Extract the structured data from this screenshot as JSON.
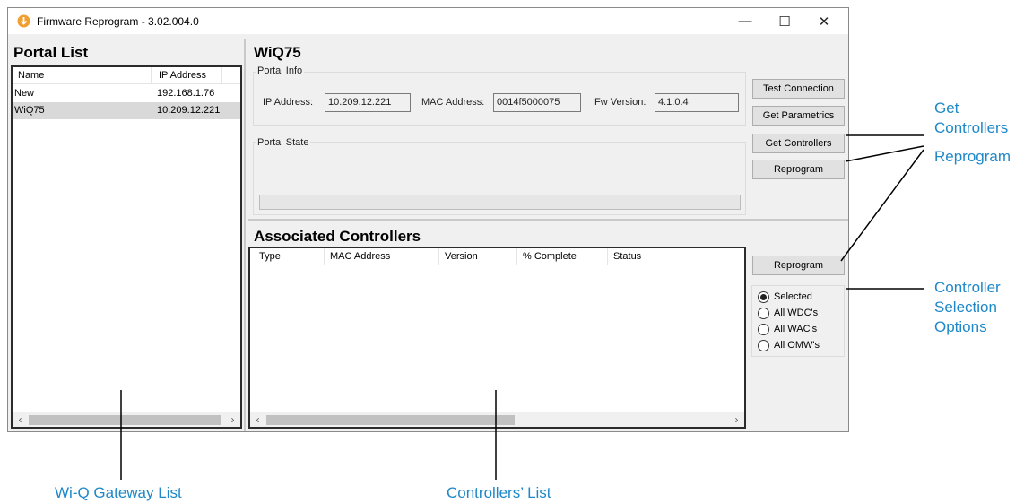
{
  "window": {
    "title": "Firmware Reprogram - 3.02.004.0",
    "controls": {
      "minimize": "—",
      "maximize": "☐",
      "close": "✕"
    }
  },
  "portal_list": {
    "title": "Portal List",
    "columns": [
      "Name",
      "IP Address"
    ],
    "rows": [
      {
        "name": "New",
        "ip": "192.168.1.76",
        "selected": false
      },
      {
        "name": "WiQ75",
        "ip": "10.209.12.221",
        "selected": true
      }
    ]
  },
  "portal": {
    "name": "WiQ75",
    "info_label": "Portal Info",
    "ip_label": "IP Address:",
    "ip_value": "10.209.12.221",
    "mac_label": "MAC Address:",
    "mac_value": "0014f5000075",
    "fw_label": "Fw Version:",
    "fw_value": "4.1.0.4",
    "state_label": "Portal State",
    "progress": 0
  },
  "buttons": {
    "test_connection": "Test Connection",
    "get_parametrics": "Get Parametrics",
    "get_controllers": "Get Controllers",
    "reprogram_portal": "Reprogram",
    "reprogram_controllers": "Reprogram"
  },
  "controllers": {
    "title": "Associated Controllers",
    "columns": [
      "Type",
      "MAC Address",
      "Version",
      "% Complete",
      "Status"
    ],
    "rows": []
  },
  "selection": {
    "options": [
      {
        "label": "Selected",
        "checked": true
      },
      {
        "label": "All WDC's",
        "checked": false
      },
      {
        "label": "All WAC's",
        "checked": false
      },
      {
        "label": "All OMW's",
        "checked": false
      }
    ]
  },
  "scroll": {
    "left_arrow": "‹",
    "right_arrow": "›"
  },
  "callouts": {
    "get_controllers": [
      "Get",
      "Controllers"
    ],
    "reprogram": "Reprogram",
    "selection_options": [
      "Controller",
      "Selection",
      "Options"
    ],
    "gateway_list": "Wi-Q Gateway List",
    "controllers_list": "Controllers’ List"
  },
  "colors": {
    "callout": "#1e88c8",
    "selected_row": "#d9d9d9",
    "app_icon": "#f0a030"
  }
}
